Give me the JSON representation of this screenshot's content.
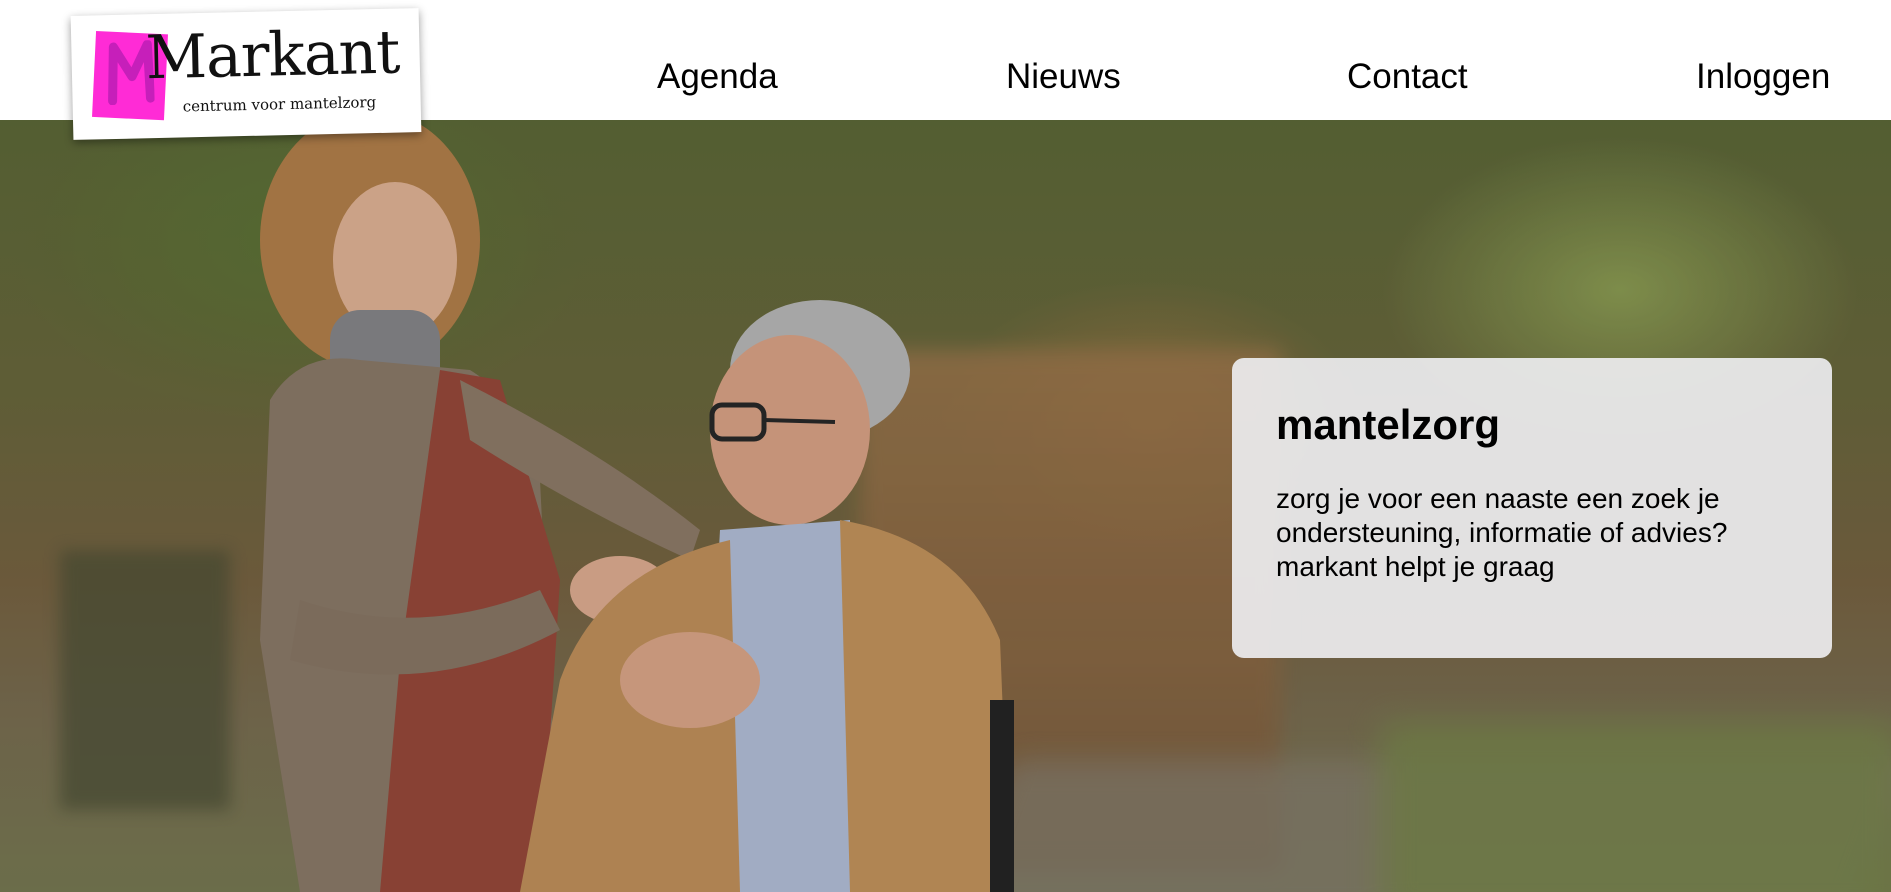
{
  "brand": {
    "name": "Markant",
    "tagline": "centrum voor mantelzorg",
    "accent_color": "#ff2bd6"
  },
  "nav": {
    "items": [
      {
        "label": "Agenda"
      },
      {
        "label": "Nieuws"
      },
      {
        "label": "Contact"
      },
      {
        "label": "Inloggen"
      }
    ]
  },
  "hero": {
    "image_subject": "caregiver-with-elderly-man-photo",
    "card": {
      "title": "mantelzorg",
      "text": "zorg je voor een naaste een zoek je ondersteuning, informatie of advies? markant helpt je graag"
    }
  }
}
